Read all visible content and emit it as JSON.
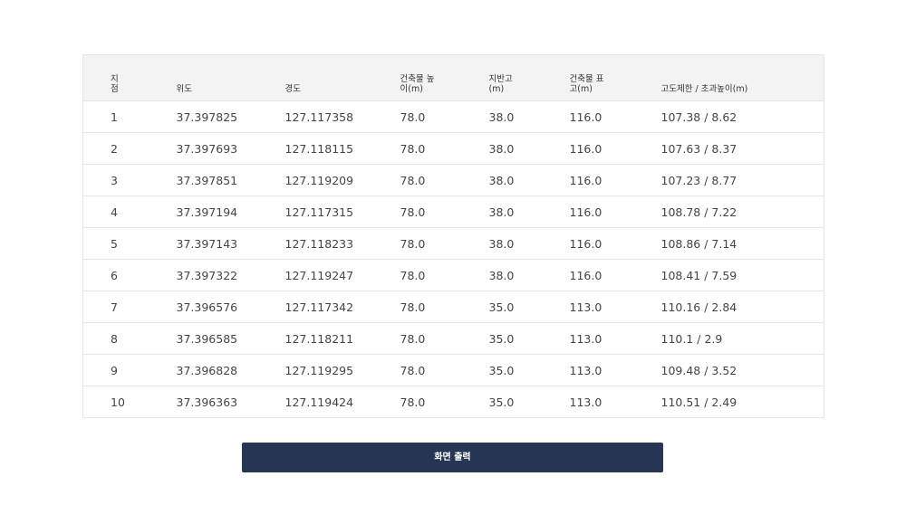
{
  "table": {
    "headers": [
      [
        "지",
        "점"
      ],
      [
        "위도"
      ],
      [
        "경도"
      ],
      [
        "건축물 높",
        "이(m)"
      ],
      [
        "지반고",
        "(m)"
      ],
      [
        "건축물 표",
        "고(m)"
      ],
      [
        "고도제한 / 초과높이(m)"
      ]
    ],
    "rows": [
      [
        "1",
        "37.397825",
        "127.117358",
        "78.0",
        "38.0",
        "116.0",
        "107.38 / 8.62"
      ],
      [
        "2",
        "37.397693",
        "127.118115",
        "78.0",
        "38.0",
        "116.0",
        "107.63 / 8.37"
      ],
      [
        "3",
        "37.397851",
        "127.119209",
        "78.0",
        "38.0",
        "116.0",
        "107.23 / 8.77"
      ],
      [
        "4",
        "37.397194",
        "127.117315",
        "78.0",
        "38.0",
        "116.0",
        "108.78 / 7.22"
      ],
      [
        "5",
        "37.397143",
        "127.118233",
        "78.0",
        "38.0",
        "116.0",
        "108.86 / 7.14"
      ],
      [
        "6",
        "37.397322",
        "127.119247",
        "78.0",
        "38.0",
        "116.0",
        "108.41 / 7.59"
      ],
      [
        "7",
        "37.396576",
        "127.117342",
        "78.0",
        "35.0",
        "113.0",
        "110.16 / 2.84"
      ],
      [
        "8",
        "37.396585",
        "127.118211",
        "78.0",
        "35.0",
        "113.0",
        "110.1 / 2.9"
      ],
      [
        "9",
        "37.396828",
        "127.119295",
        "78.0",
        "35.0",
        "113.0",
        "109.48 / 3.52"
      ],
      [
        "10",
        "37.396363",
        "127.119424",
        "78.0",
        "35.0",
        "113.0",
        "110.51 / 2.49"
      ]
    ]
  },
  "print_button": {
    "label": "화면 출력",
    "color": "#283655"
  }
}
